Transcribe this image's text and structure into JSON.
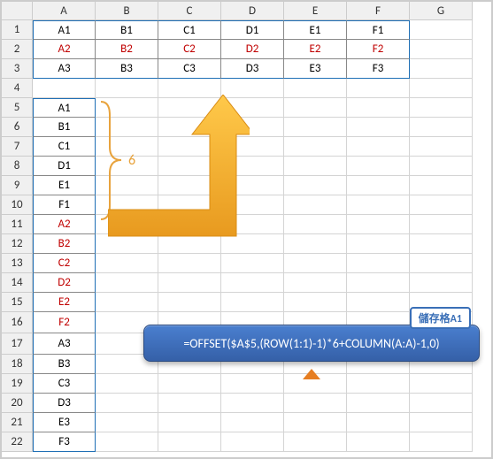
{
  "columns": [
    "A",
    "B",
    "C",
    "D",
    "E",
    "F",
    "G"
  ],
  "rows": [
    "1",
    "2",
    "3",
    "4",
    "5",
    "6",
    "7",
    "8",
    "9",
    "10",
    "11",
    "12",
    "13",
    "14",
    "15",
    "16",
    "17",
    "18",
    "19",
    "20",
    "21",
    "22"
  ],
  "top_grid": {
    "r1": [
      "A1",
      "B1",
      "C1",
      "D1",
      "E1",
      "F1"
    ],
    "r2": [
      "A2",
      "B2",
      "C2",
      "D2",
      "E2",
      "F2"
    ],
    "r3": [
      "A3",
      "B3",
      "C3",
      "D3",
      "E3",
      "F3"
    ]
  },
  "colA": [
    "A1",
    "B1",
    "C1",
    "D1",
    "E1",
    "F1",
    "A2",
    "B2",
    "C2",
    "D2",
    "E2",
    "F2",
    "A3",
    "B3",
    "C3",
    "D3",
    "E3",
    "F3"
  ],
  "brace_label": "6",
  "callout": {
    "tab": "儲存格A1",
    "formula": "=OFFSET($A$5,(ROW(1:1)-1)*6+COLUMN(A:A)-1,0)"
  },
  "chart_data": null
}
